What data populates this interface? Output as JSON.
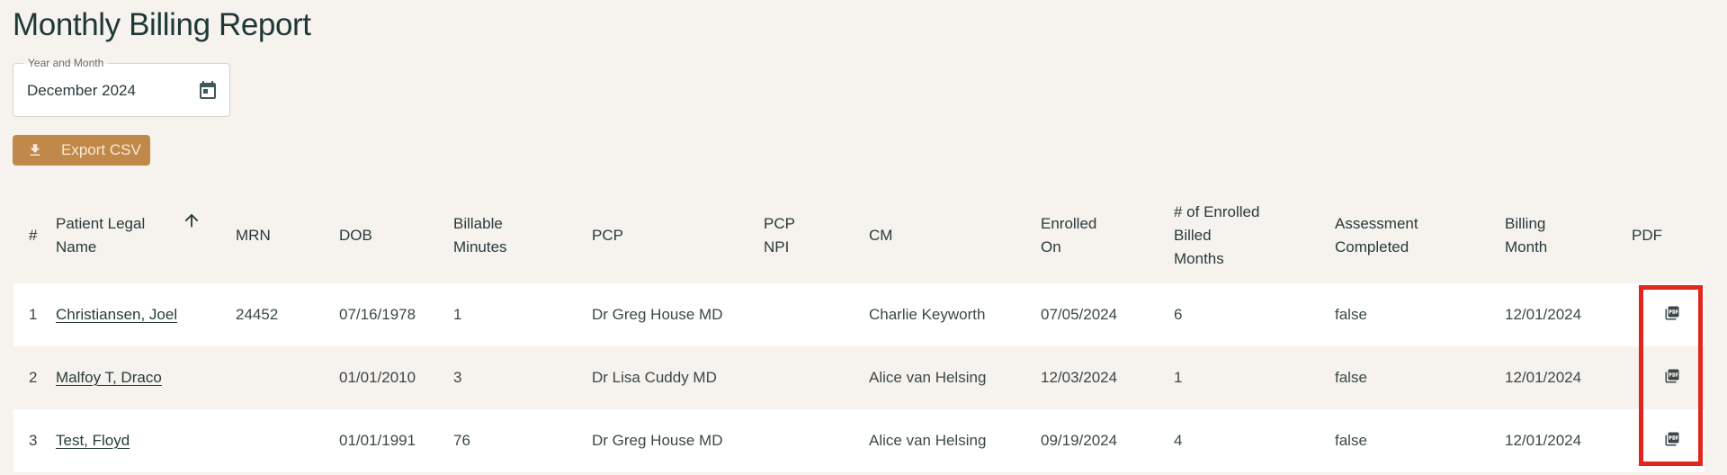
{
  "page": {
    "title": "Monthly Billing Report"
  },
  "date_picker": {
    "label": "Year and Month",
    "value": "December 2024",
    "icon": "calendar-icon"
  },
  "export": {
    "label": "Export CSV",
    "icon": "download-icon"
  },
  "table": {
    "columns": [
      {
        "key": "num",
        "label": "#"
      },
      {
        "key": "name",
        "label": "Patient Legal Name",
        "sorted": "ascending"
      },
      {
        "key": "mrn",
        "label": "MRN"
      },
      {
        "key": "dob",
        "label": "DOB"
      },
      {
        "key": "minutes",
        "label": "Billable Minutes"
      },
      {
        "key": "pcp",
        "label": "PCP"
      },
      {
        "key": "pcp_npi",
        "label": "PCP NPI"
      },
      {
        "key": "cm",
        "label": "CM"
      },
      {
        "key": "enrolled_on",
        "label": "Enrolled On"
      },
      {
        "key": "enrolled_months",
        "label": "# of Enrolled Billed Months"
      },
      {
        "key": "assessment",
        "label": "Assessment Completed"
      },
      {
        "key": "billing_month",
        "label": "Billing Month"
      },
      {
        "key": "pdf",
        "label": "PDF"
      }
    ],
    "header_lines": {
      "name": [
        "Patient Legal",
        "Name"
      ],
      "minutes": [
        "Billable",
        "Minutes"
      ],
      "pcp_npi": [
        "PCP",
        "NPI"
      ],
      "enrolled_on": [
        "Enrolled",
        "On"
      ],
      "enrolled_months": [
        "# of Enrolled",
        "Billed",
        "Months"
      ],
      "assessment": [
        "Assessment",
        "Completed"
      ],
      "billing_month": [
        "Billing",
        "Month"
      ]
    },
    "rows": [
      {
        "num": "1",
        "name": "Christiansen, Joel",
        "mrn": "24452",
        "dob": "07/16/1978",
        "minutes": "1",
        "pcp": "Dr Greg House MD",
        "pcp_npi": "",
        "cm": "Charlie Keyworth",
        "enrolled_on": "07/05/2024",
        "enrolled_months": "6",
        "assessment": "false",
        "billing_month": "12/01/2024"
      },
      {
        "num": "2",
        "name": "Malfoy T, Draco",
        "mrn": "",
        "dob": "01/01/2010",
        "minutes": "3",
        "pcp": "Dr Lisa Cuddy MD",
        "pcp_npi": "",
        "cm": "Alice van Helsing",
        "enrolled_on": "12/03/2024",
        "enrolled_months": "1",
        "assessment": "false",
        "billing_month": "12/01/2024"
      },
      {
        "num": "3",
        "name": "Test, Floyd",
        "mrn": "",
        "dob": "01/01/1991",
        "minutes": "76",
        "pcp": "Dr Greg House MD",
        "pcp_npi": "",
        "cm": "Alice van Helsing",
        "enrolled_on": "09/19/2024",
        "enrolled_months": "4",
        "assessment": "false",
        "billing_month": "12/01/2024"
      }
    ]
  },
  "colors": {
    "background": "#f6f2ed",
    "accent": "#c0894a",
    "text": "#283b3b",
    "highlight": "#e3261c"
  }
}
